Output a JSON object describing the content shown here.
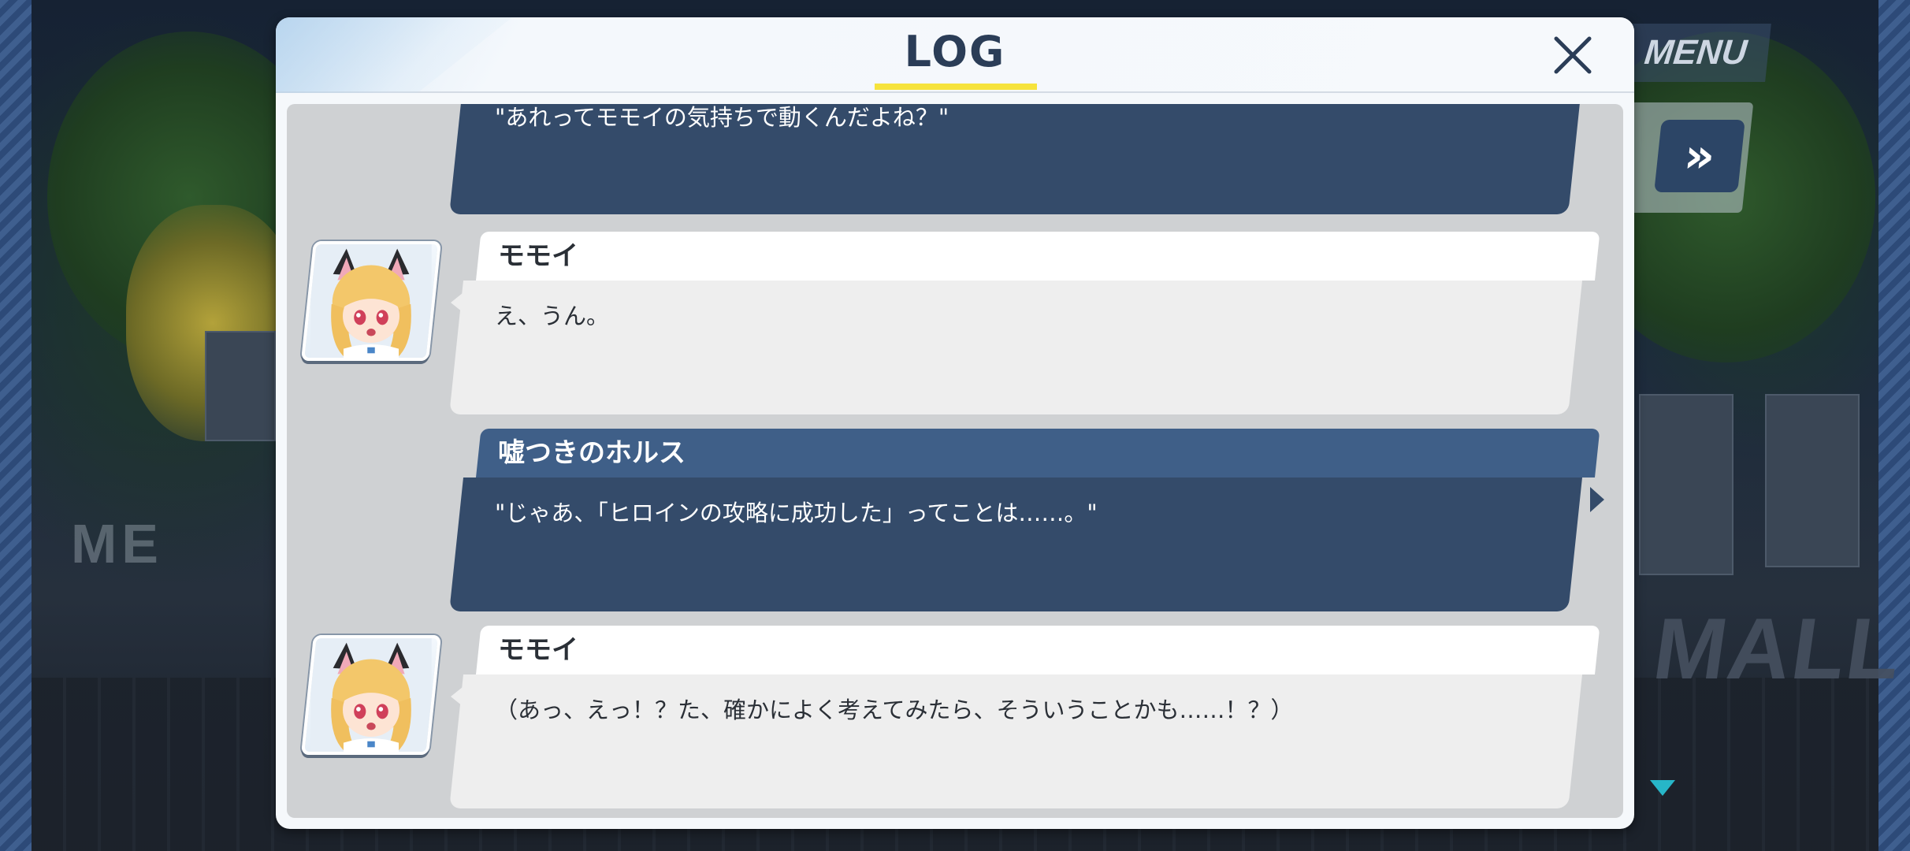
{
  "dialog": {
    "title": "LOG"
  },
  "controls": {
    "menu_label": "MENU",
    "fast_forward_glyph": "»"
  },
  "log_entries": [
    {
      "speaker": "",
      "text": "\"あれってモモイの気持ちで動くんだよね？\"",
      "style": "player"
    },
    {
      "speaker": "モモイ",
      "text": "え、うん。",
      "style": "character"
    },
    {
      "speaker": "嘘つきのホルス",
      "text": "\"じゃあ、「ヒロインの攻略に成功した」ってことは……。\"",
      "style": "player"
    },
    {
      "speaker": "モモイ",
      "text": "（あっ、えっ！？た、確かによく考えてみたら、そういうことかも……！？）",
      "style": "character"
    }
  ],
  "background_text": {
    "left_sign": "ME",
    "right_sign": "MALL"
  },
  "colors": {
    "title_underline": "#f6e33c",
    "player_bubble": "#344b6a",
    "player_name_bar": "#3f5f88",
    "character_bubble": "#eeeeee",
    "accent_arrow": "#27b6c8"
  },
  "icons": {
    "close": "close-icon",
    "fast_forward": "fast-forward-icon",
    "scroll_down": "triangle-down-icon"
  }
}
